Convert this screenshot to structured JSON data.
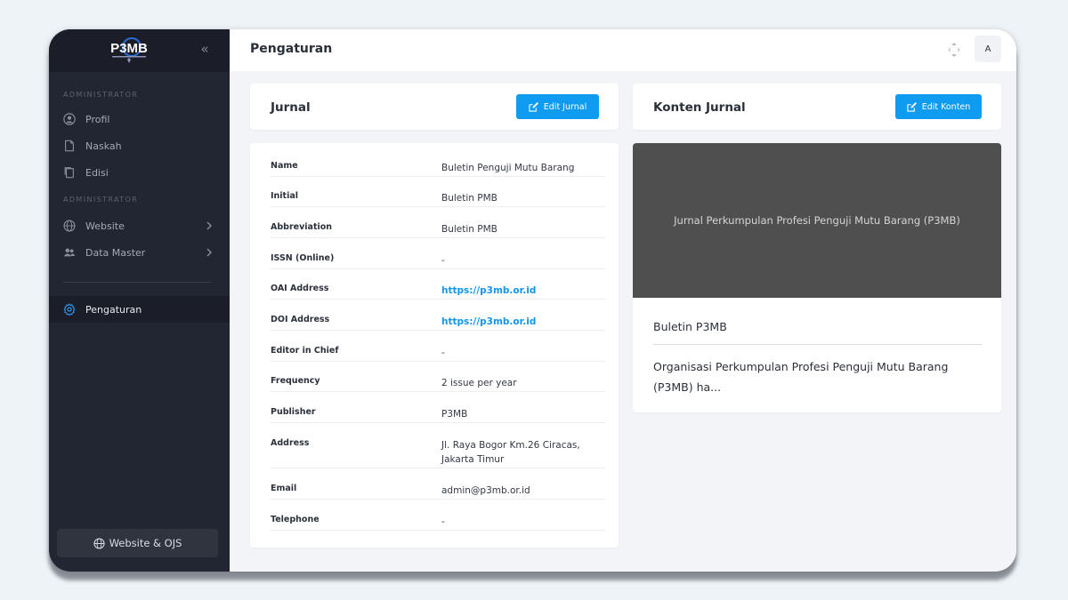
{
  "sidebar": {
    "logo_text": "P3MB",
    "section1": "ADMINISTRATOR",
    "section2": "ADMINISTRATOR",
    "items": [
      {
        "label": "Profil",
        "icon": "user-circle-icon"
      },
      {
        "label": "Naskah",
        "icon": "document-icon"
      },
      {
        "label": "Edisi",
        "icon": "copy-icon"
      },
      {
        "label": "Website",
        "icon": "globe-icon"
      },
      {
        "label": "Data Master",
        "icon": "users-icon"
      },
      {
        "label": "Pengaturan",
        "icon": "gear-icon"
      }
    ],
    "footer_button": "Website & OJS"
  },
  "topbar": {
    "title": "Pengaturan",
    "avatar": "A"
  },
  "journal": {
    "title": "Jurnal",
    "edit_button": "Edit Jurnal",
    "rows": [
      {
        "key": "Name",
        "value": "Buletin Penguji Mutu Barang"
      },
      {
        "key": "Initial",
        "value": "Buletin PMB"
      },
      {
        "key": "Abbreviation",
        "value": "Buletin PMB"
      },
      {
        "key": "ISSN (Online)",
        "value": "-"
      },
      {
        "key": "OAI Address",
        "value": "https://p3mb.or.id"
      },
      {
        "key": "DOI Address",
        "value": "https://p3mb.or.id"
      },
      {
        "key": "Editor in Chief",
        "value": "-"
      },
      {
        "key": "Frequency",
        "value": "2 issue per year"
      },
      {
        "key": "Publisher",
        "value": "P3MB"
      },
      {
        "key": "Address",
        "value": "Jl. Raya Bogor Km.26 Ciracas, Jakarta Timur"
      },
      {
        "key": "Email",
        "value": "admin@p3mb.or.id"
      },
      {
        "key": "Telephone",
        "value": "-"
      }
    ]
  },
  "content": {
    "title": "Konten Jurnal",
    "edit_button": "Edit Konten",
    "banner_text": "Jurnal Perkumpulan Profesi Penguji Mutu Barang (P3MB)",
    "name": "Buletin P3MB",
    "description": "Organisasi Perkumpulan Profesi Penguji Mutu Barang (P3MB) ha..."
  },
  "colors": {
    "sidebar": "#222532",
    "primary": "#0f9bef",
    "link": "#1496e8",
    "banner": "#4f4f4f"
  }
}
